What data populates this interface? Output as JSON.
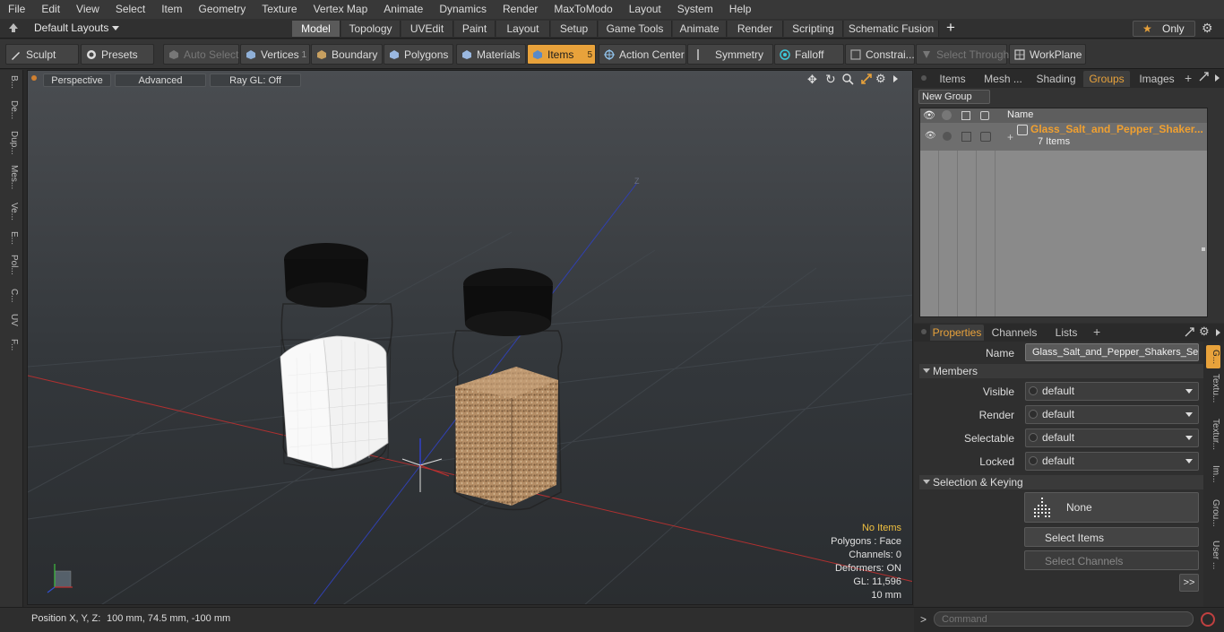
{
  "menu": [
    "File",
    "Edit",
    "View",
    "Select",
    "Item",
    "Geometry",
    "Texture",
    "Vertex Map",
    "Animate",
    "Dynamics",
    "Render",
    "MaxToModo",
    "Layout",
    "System",
    "Help"
  ],
  "layout_selector": "Default Layouts",
  "layout_tabs": [
    "Model",
    "Topology",
    "UVEdit",
    "Paint",
    "Layout",
    "Setup",
    "Game Tools",
    "Animate",
    "Render",
    "Scripting",
    "Schematic Fusion"
  ],
  "active_layout_tab": "Model",
  "only_label": "Only",
  "toolbar": {
    "sculpt": "Sculpt",
    "presets": "Presets",
    "auto_select": "Auto Select",
    "vertices": "Vertices",
    "vertices_count": "1",
    "boundary": "Boundary",
    "polygons": "Polygons",
    "materials": "Materials",
    "items": "Items",
    "items_count": "5",
    "action_center": "Action Center",
    "symmetry": "Symmetry",
    "falloff": "Falloff",
    "constraints": "Constrai...",
    "select_through": "Select Through",
    "workplane": "WorkPlane"
  },
  "left_strip": [
    "B...",
    "De...",
    "Dup...",
    "Mes...",
    "Ve...",
    "E...",
    "Pol...",
    "C...",
    "UV",
    "F..."
  ],
  "viewport": {
    "view_mode": "Perspective",
    "shading": "Advanced",
    "raygl": "Ray GL: Off",
    "info": [
      "No Items",
      "Polygons : Face",
      "Channels: 0",
      "Deformers: ON",
      "GL: 11,596",
      "10 mm"
    ],
    "axis_z_label": "Z"
  },
  "status": {
    "label": "Position X, Y, Z:",
    "value": "100 mm, 74.5 mm, -100 mm"
  },
  "right_panel": {
    "top_tabs": [
      "Items",
      "Mesh ...",
      "Shading",
      "Groups",
      "Images"
    ],
    "active_top_tab": "Groups",
    "new_group": "New Group",
    "list_header": "Name",
    "group_name": "Glass_Salt_and_Pepper_Shaker...",
    "group_count": "7 Items",
    "prop_tabs": [
      "Properties",
      "Channels",
      "Lists"
    ],
    "active_prop_tab": "Properties",
    "name_label": "Name",
    "name_value": "Glass_Salt_and_Pepper_Shakers_Set",
    "members_section": "Members",
    "members": [
      {
        "label": "Visible",
        "value": "default"
      },
      {
        "label": "Render",
        "value": "default"
      },
      {
        "label": "Selectable",
        "value": "default"
      },
      {
        "label": "Locked",
        "value": "default"
      }
    ],
    "selection_section": "Selection & Keying",
    "none_label": "None",
    "select_items": "Select Items",
    "select_channels": "Select Channels",
    "more": ">>",
    "side_tabs": [
      "G...",
      "Textu...",
      "Textur...",
      "Im...",
      "Grou...",
      "User ..."
    ],
    "command_placeholder": "Command",
    "command_prompt": ">"
  },
  "colors": {
    "accent": "#e8a23b",
    "group_name": "#f0a030"
  }
}
